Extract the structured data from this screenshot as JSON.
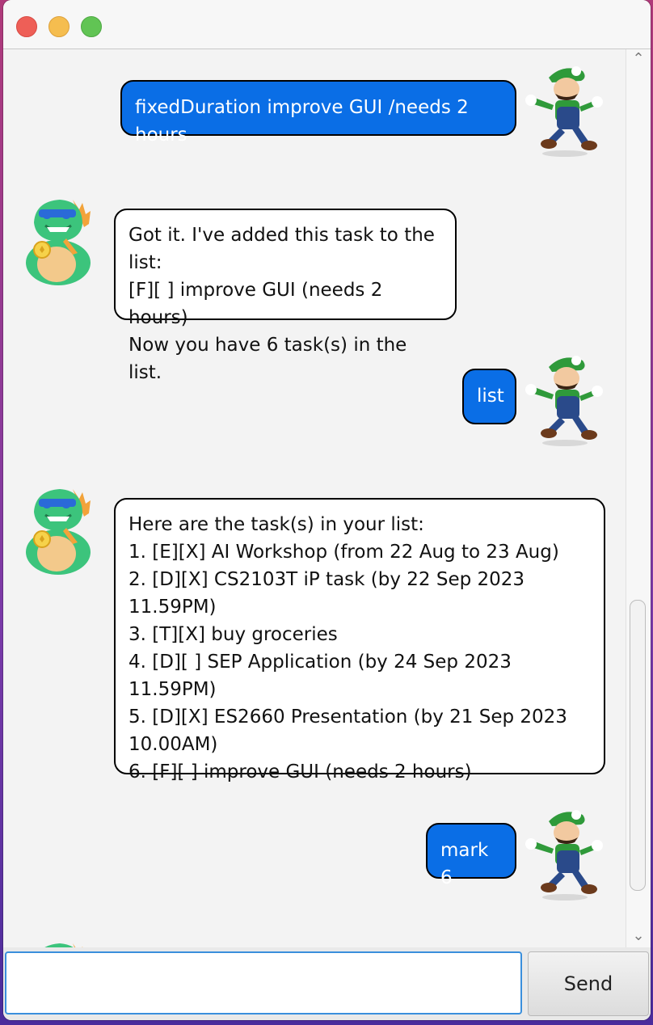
{
  "window": {
    "buttons": [
      "close",
      "minimize",
      "maximize"
    ]
  },
  "chat": {
    "messages": [
      {
        "sender": "user",
        "text": "fixedDuration improve GUI /needs 2 hours"
      },
      {
        "sender": "bot",
        "text": "Got it. I've added this task to the list:\n[F][ ] improve GUI (needs 2 hours)\nNow you have 6 task(s) in the list."
      },
      {
        "sender": "user",
        "text": "list"
      },
      {
        "sender": "bot",
        "text": "Here are the task(s) in your list:\n1. [E][X] AI Workshop (from 22 Aug to 23 Aug)\n2. [D][X] CS2103T iP task (by 22 Sep 2023\n11.59PM)\n3. [T][X] buy groceries\n4. [D][ ] SEP Application (by 24 Sep 2023 11.59PM)\n5. [D][X] ES2660 Presentation (by 21 Sep 2023\n10.00AM)\n6. [F][ ] improve GUI (needs 2 hours)"
      },
      {
        "sender": "user",
        "text": "mark 6"
      }
    ],
    "user_avatar_icon": "luigi-avatar-icon",
    "bot_avatar_icon": "green-dinosaur-avatar-icon",
    "user_bubble_color": "#0a6ee6",
    "bot_bubble_color": "#ffffff"
  },
  "input": {
    "value": "",
    "placeholder": "",
    "send_label": "Send"
  }
}
